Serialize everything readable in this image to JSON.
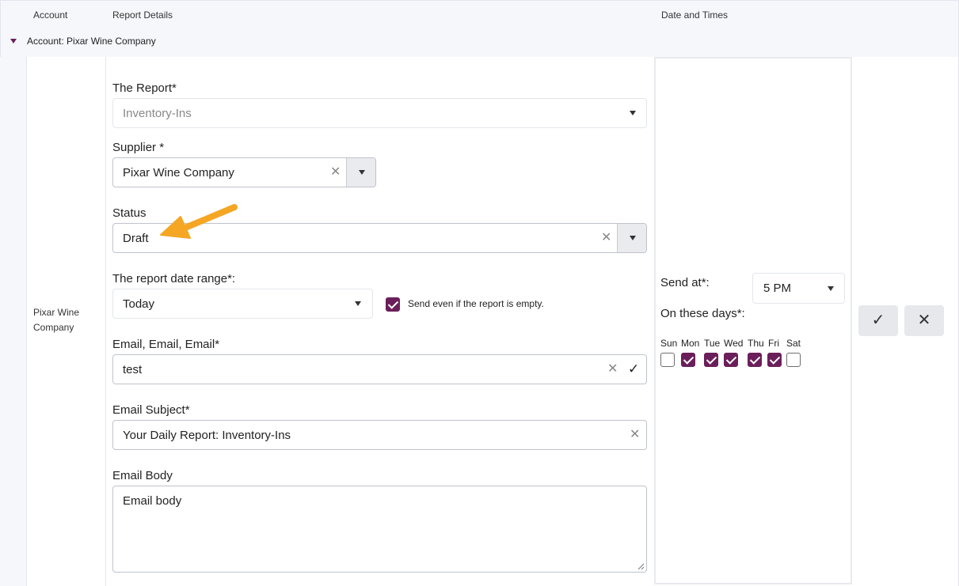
{
  "header": {
    "account": "Account",
    "report_details": "Report Details",
    "date_and_times": "Date and Times"
  },
  "group": {
    "label": "Account: Pixar Wine Company"
  },
  "row": {
    "account_name": "Pixar Wine Company"
  },
  "form": {
    "report_label": "The Report*",
    "report_value": "Inventory-Ins",
    "supplier_label": "Supplier *",
    "supplier_value": "Pixar Wine Company",
    "status_label": "Status",
    "status_value": "Draft",
    "date_range_label": "The report date range*:",
    "date_range_value": "Today",
    "send_empty_label": "Send even if the report is empty.",
    "send_empty_checked": true,
    "email_label": "Email, Email, Email*",
    "email_value": "test",
    "subject_label": "Email Subject*",
    "subject_value": "Your Daily Report: Inventory-Ins",
    "body_label": "Email Body",
    "body_value": "Email body"
  },
  "schedule": {
    "send_at_label": "Send at*:",
    "send_at_value": "5 PM",
    "days_label": "On these days*:",
    "days": [
      {
        "label": "Sun",
        "checked": false
      },
      {
        "label": "Mon",
        "checked": true
      },
      {
        "label": "Tue",
        "checked": true
      },
      {
        "label": "Wed",
        "checked": true
      },
      {
        "label": "Thu",
        "checked": true
      },
      {
        "label": "Fri",
        "checked": true
      },
      {
        "label": "Sat",
        "checked": false
      }
    ]
  },
  "icons": {
    "clear": "close-icon",
    "dropdown": "caret-down-icon",
    "valid": "check-icon",
    "save": "check-icon",
    "cancel": "close-icon",
    "annotation": "arrow-annotation-icon"
  },
  "colors": {
    "accent": "#6b1f5a",
    "annotation_arrow": "#f5a623",
    "header_bg": "#f5f7fb"
  }
}
